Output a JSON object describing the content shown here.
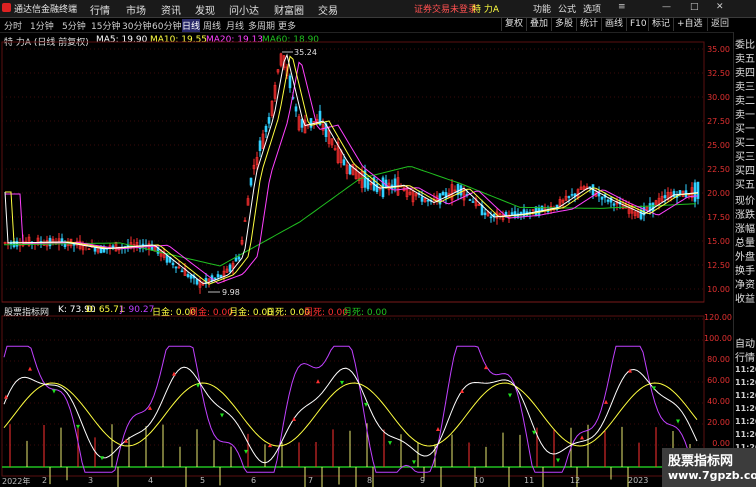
{
  "app": {
    "title": "通达信金融终端",
    "notice": "证券交易未登录",
    "stock_badge": "特 力A"
  },
  "menu": [
    "行情",
    "市场",
    "资讯",
    "发现",
    "问小达",
    "财富圈",
    "交易"
  ],
  "right_menu": [
    "功能",
    "公式",
    "选项"
  ],
  "periods": [
    "分时",
    "1分钟",
    "5分钟",
    "15分钟",
    "30分钟",
    "60分钟",
    "日线",
    "周线",
    "月线",
    "多周期",
    "更多"
  ],
  "active_period": "日线",
  "tool_buttons": [
    "复权",
    "叠加",
    "多股",
    "统计",
    "画线",
    "F10",
    "标记",
    "+自选",
    "返回"
  ],
  "price_legend": {
    "name": "特 力A (日线 前复权)",
    "ma5": "MA5: 19.90",
    "ma10": "MA10: 19.55",
    "ma20": "MA20: 19.13",
    "ma60": "MA60: 18.90"
  },
  "price_axis": [
    "35.00",
    "32.50",
    "30.00",
    "27.50",
    "25.00",
    "22.50",
    "20.00",
    "17.50",
    "15.00",
    "12.50",
    "10.00"
  ],
  "annotations": {
    "high": "35.24",
    "low": "9.98"
  },
  "indicator_legend": {
    "name": "股票指标网",
    "k": "K: 73.90",
    "d": "D: 65.71",
    "j": "J: 90.27",
    "rijin": "日金: 0.00",
    "zhoujin": "周金: 0.00",
    "yuejin": "月金: 0.00",
    "risi": "日死: 0.00",
    "zhousi": "周死: 0.00",
    "yuesi": "月死: 0.00"
  },
  "indicator_axis": [
    "120.00",
    "100.00",
    "80.00",
    "60.00",
    "40.00",
    "20.00",
    "0.00"
  ],
  "x_axis": [
    "2022年",
    "2",
    "3",
    "4",
    "5",
    "6",
    "7",
    "8",
    "9",
    "10",
    "11",
    "12",
    "2023"
  ],
  "sidebar": {
    "labels": [
      "委比",
      "卖五",
      "卖四",
      "卖三",
      "卖二",
      "卖一",
      "买一",
      "买二",
      "买三",
      "买四",
      "买五",
      "现价",
      "涨跌",
      "涨幅",
      "总量",
      "外盘",
      "换手",
      "净资",
      "收益"
    ],
    "bottom_labels": [
      "自动",
      "行情"
    ],
    "times": [
      "11:26",
      "11:26",
      "11:26",
      "11:26",
      "11:26",
      "11:26",
      "11:26",
      "11:26",
      "11:26"
    ]
  },
  "watermark": {
    "line1": "股票指标网",
    "line2": "www.7gpzb.com"
  },
  "colors": {
    "up": "#ff3030",
    "down": "#30d0ff",
    "ma5": "#ffffff",
    "ma10": "#ffff40",
    "ma20": "#ff40ff",
    "ma60": "#20c020"
  }
}
